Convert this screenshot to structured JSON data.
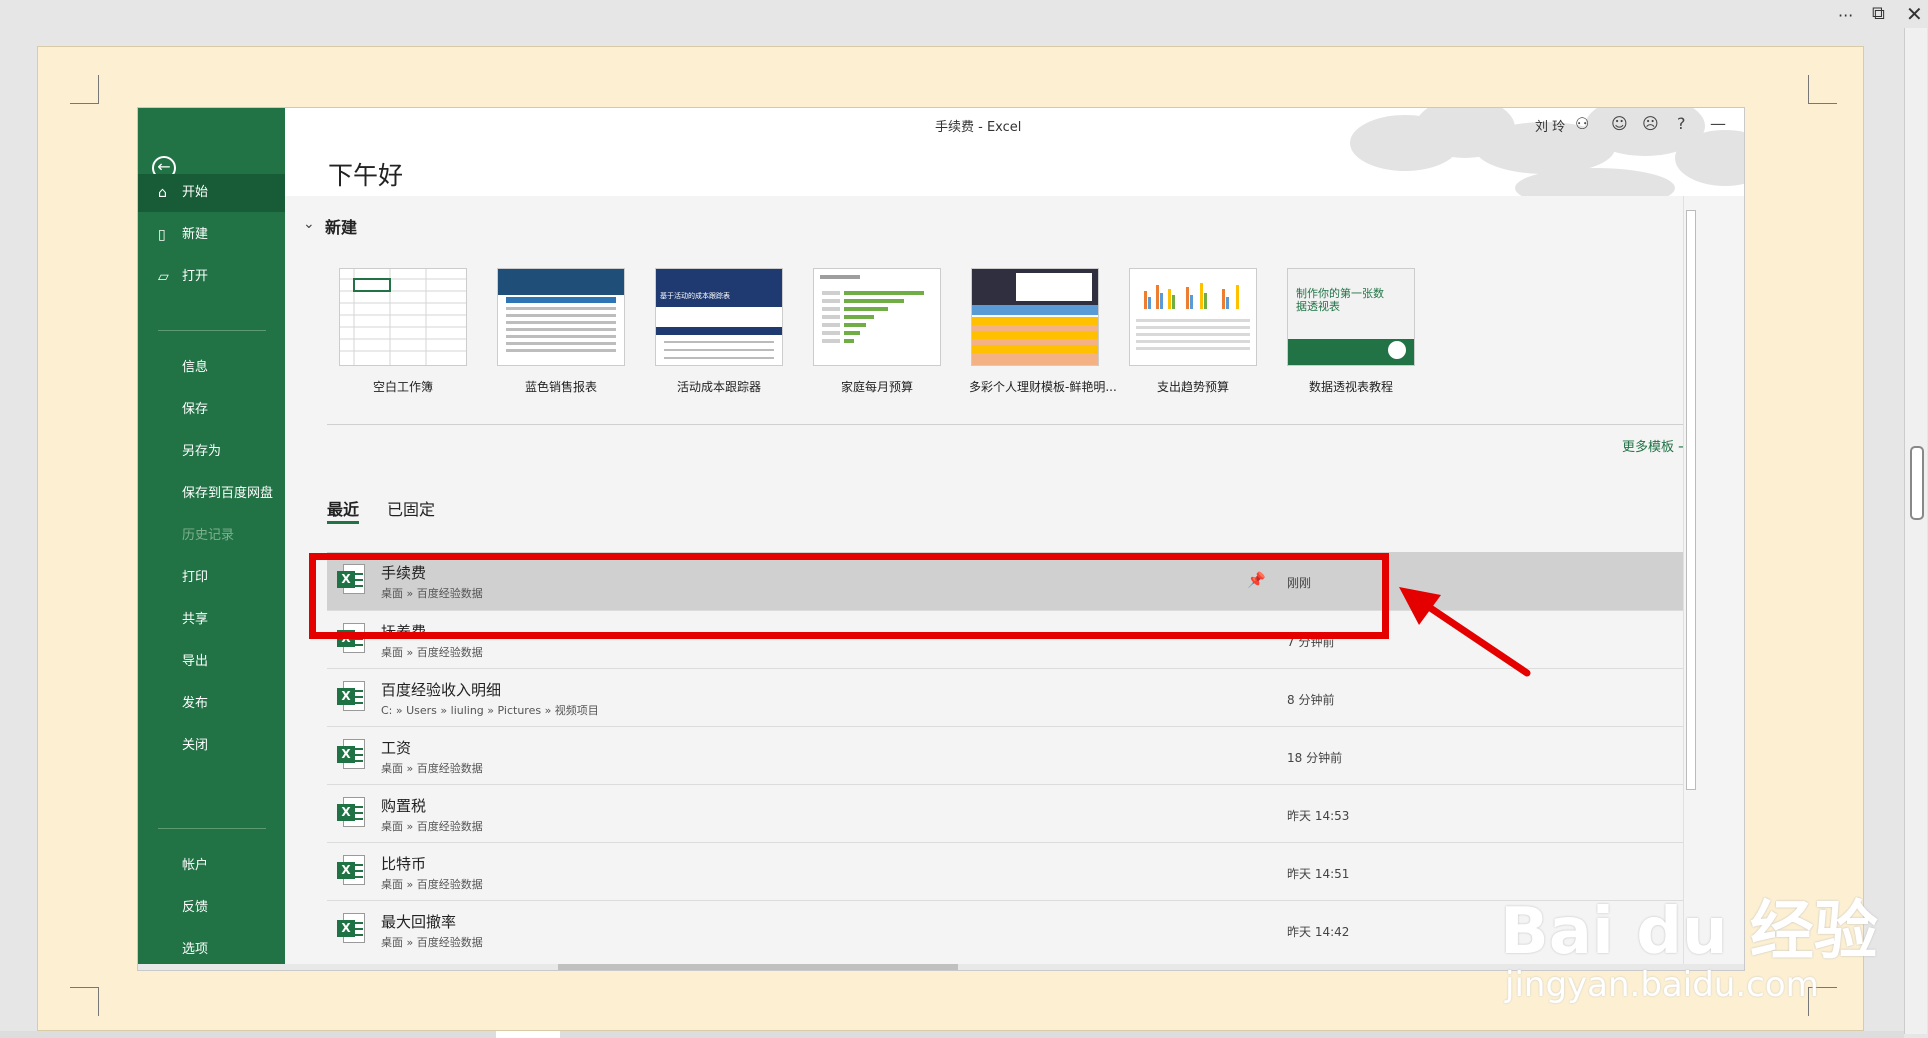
{
  "outer": {
    "more_label": "···"
  },
  "excel_window": {
    "title": "手续费 - Excel",
    "user": "刘 玲"
  },
  "sidebar": {
    "items": [
      {
        "label": "开始",
        "icon": "home-icon",
        "active": true
      },
      {
        "label": "新建",
        "icon": "new-document-icon"
      },
      {
        "label": "打开",
        "icon": "folder-open-icon"
      },
      {
        "label": "信息"
      },
      {
        "label": "保存"
      },
      {
        "label": "另存为"
      },
      {
        "label": "保存到百度网盘"
      },
      {
        "label": "历史记录",
        "disabled": true
      },
      {
        "label": "打印"
      },
      {
        "label": "共享"
      },
      {
        "label": "导出"
      },
      {
        "label": "发布"
      },
      {
        "label": "关闭"
      },
      {
        "label": "帐户"
      },
      {
        "label": "反馈"
      },
      {
        "label": "选项"
      }
    ]
  },
  "greeting": "下午好",
  "new_section": {
    "title": "新建",
    "more_templates": "更多模板 →",
    "templates": [
      {
        "name": "空白工作簿"
      },
      {
        "name": "蓝色销售报表"
      },
      {
        "name": "活动成本跟踪器",
        "thumb_text": "基于活动的成本跟踪表"
      },
      {
        "name": "家庭每月预算"
      },
      {
        "name": "多彩个人理财模板-鲜艳明..."
      },
      {
        "name": "支出趋势预算"
      },
      {
        "name": "数据透视表教程",
        "thumb_text": "制作你的第一张数据透视表"
      }
    ]
  },
  "tabs": {
    "recent": "最近",
    "pinned": "已固定"
  },
  "recent_files": [
    {
      "name": "手续费",
      "path": "桌面 » 百度经验数据",
      "time": "刚刚",
      "selected": true
    },
    {
      "name": "抚养费",
      "path": "桌面 » 百度经验数据",
      "time": "7 分钟前"
    },
    {
      "name": "百度经验收入明细",
      "path": "C: » Users » liuling » Pictures » 视频项目",
      "time": "8 分钟前"
    },
    {
      "name": "工资",
      "path": "桌面 » 百度经验数据",
      "time": "18 分钟前"
    },
    {
      "name": "购置税",
      "path": "桌面 » 百度经验数据",
      "time": "昨天 14:53"
    },
    {
      "name": "比特币",
      "path": "桌面 » 百度经验数据",
      "time": "昨天 14:51"
    },
    {
      "name": "最大回撤率",
      "path": "桌面 » 百度经验数据",
      "time": "昨天 14:42"
    }
  ],
  "watermark": {
    "logo": "Bai du 经验",
    "url": "jingyan.baidu.com"
  },
  "colors": {
    "excel_green": "#217346",
    "sidebar_active": "#185c37",
    "highlight_red": "#e50000",
    "page_bg": "#fdf0d2"
  }
}
